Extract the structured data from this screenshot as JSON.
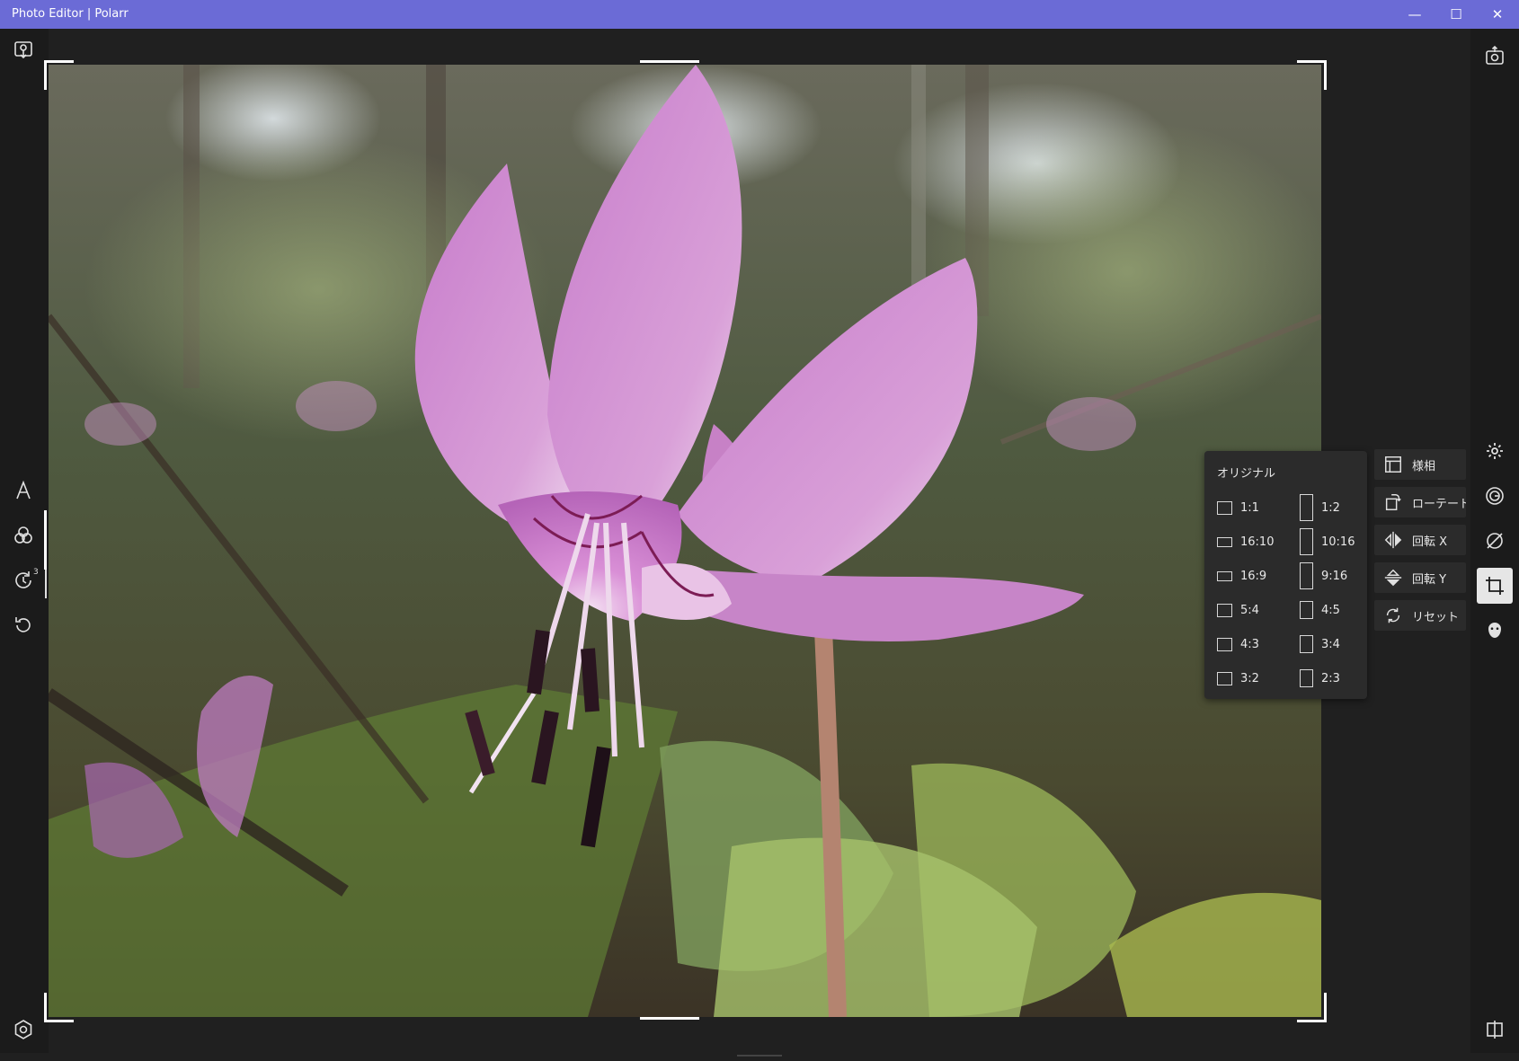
{
  "window": {
    "title": "Photo Editor | Polarr",
    "minimize": "—",
    "maximize": "☐",
    "close": "✕"
  },
  "left_tools": {
    "import_icon": "import-icon",
    "text_icon": "text-icon",
    "filters_icon": "filters-icon",
    "history_icon": "history-icon",
    "history_badge": "3",
    "undo_icon": "undo-icon",
    "settings_icon": "settings-icon"
  },
  "right_tools": {
    "export_icon": "export-icon",
    "adjust_icon": "adjust-icon",
    "lens_icon": "lens-icon",
    "heal_icon": "heal-icon",
    "crop_icon": "crop-icon",
    "face_icon": "face-icon",
    "compare_icon": "compare-icon"
  },
  "crop_panel": {
    "header": "オリジナル",
    "landscape": [
      "1:1",
      "16:10",
      "16:9",
      "5:4",
      "4:3",
      "3:2"
    ],
    "portrait": [
      "1:2",
      "10:16",
      "9:16",
      "4:5",
      "3:4",
      "2:3"
    ]
  },
  "crop_actions": {
    "layout": "様相",
    "rotate": "ローテート",
    "flip_x": "回転 X",
    "flip_y": "回転 Y",
    "reset": "リセット"
  },
  "colors": {
    "titlebar": "#6b6bd6",
    "panel": "#2b2b2b",
    "sidebar": "#1b1b1b"
  }
}
